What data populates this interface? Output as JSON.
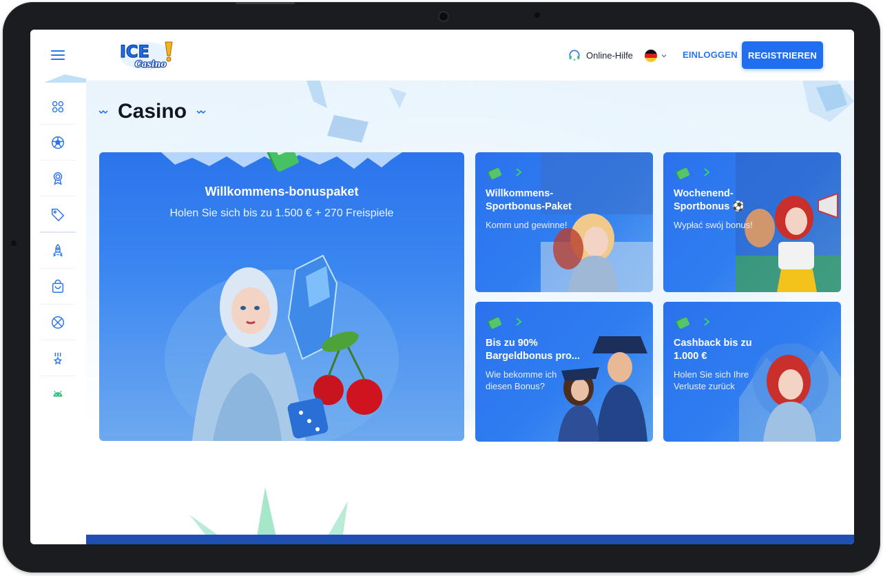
{
  "header": {
    "logo_top": "ICE",
    "logo_bottom": "Casino",
    "help_label": "Online-Hilfe",
    "login_label": "EINLOGGEN",
    "register_label": "REGISTRIEREN",
    "language_flag": "de-flag-icon"
  },
  "page": {
    "title": "Casino"
  },
  "sidebar": {
    "items": [
      {
        "icon": "grid-icon"
      },
      {
        "icon": "soccer-ball-icon"
      },
      {
        "icon": "award-ribbon-icon"
      },
      {
        "icon": "tag-icon"
      },
      {
        "icon": "rocket-icon"
      },
      {
        "icon": "shopping-bag-icon"
      },
      {
        "icon": "tennis-ball-icon"
      },
      {
        "icon": "star-medal-icon"
      },
      {
        "icon": "android-icon"
      }
    ]
  },
  "promos": {
    "main": {
      "title": "Willkommens-bonuspaket",
      "subtitle": "Holen Sie sich bis zu 1.500 € + 270 Freispiele"
    },
    "cards": [
      {
        "title": "Willkommens-Sportbonus-Paket",
        "subtitle": "Komm und gewinne!"
      },
      {
        "title": "Wochenend-Sportbonus ⚽",
        "subtitle": "Wypłać swój bonus!"
      },
      {
        "title": "Bis zu 90% Bargeldbonus pro...",
        "subtitle": "Wie bekomme ich diesen Bonus?"
      },
      {
        "title": "Cashback bis zu 1.000 €",
        "subtitle": "Holen Sie sich Ihre Verluste zurück"
      }
    ]
  },
  "colors": {
    "accent": "#1f6ff0",
    "card_blue": "#2b72ee",
    "title_text": "#121620",
    "bottom_bar": "#1f4fb3"
  }
}
